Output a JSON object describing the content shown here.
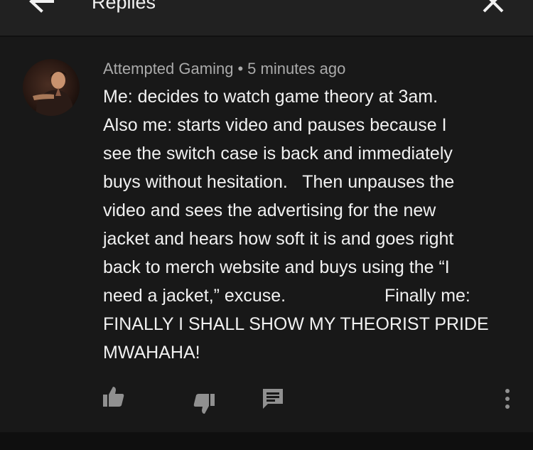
{
  "header": {
    "title": "Replies",
    "back_icon": "back-arrow-icon",
    "close_icon": "close-icon"
  },
  "comment": {
    "author": "Attempted Gaming",
    "separator": "•",
    "time": "5 minutes ago",
    "lines": [
      "Me: decides to watch game theory at 3am.",
      "Also me: starts video and pauses because I",
      "see the switch case is back and immediately",
      "buys without hesitation.   Then unpauses the",
      "video and sees the advertising for the new",
      "jacket and hears how soft it is and goes right",
      "back to merch website and buys using the “I",
      "need a jacket,” excuse.                    Finally me:",
      "FINALLY I SHALL SHOW MY THEORIST PRIDE",
      "MWAHAHA!"
    ]
  },
  "actions": {
    "like_icon": "thumb-up-icon",
    "dislike_icon": "thumb-down-icon",
    "reply_icon": "reply-comment-icon",
    "more_icon": "more-vertical-icon"
  },
  "colors": {
    "background": "#181818",
    "header_background": "#212121",
    "text_primary": "#f1f1f1",
    "text_secondary": "#aaaaaa",
    "icon_color": "#909090"
  }
}
